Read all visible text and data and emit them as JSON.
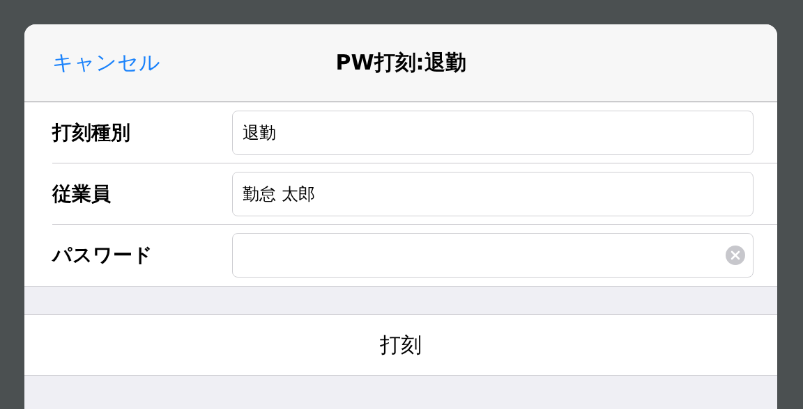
{
  "header": {
    "cancel": "キャンセル",
    "title": "PW打刻:退勤"
  },
  "fields": [
    {
      "label": "打刻種別",
      "value": "退勤",
      "clearable": false
    },
    {
      "label": "従業員",
      "value": "勤怠 太郎",
      "clearable": false
    },
    {
      "label": "パスワード",
      "clearable": true
    }
  ],
  "submit": "打刻"
}
